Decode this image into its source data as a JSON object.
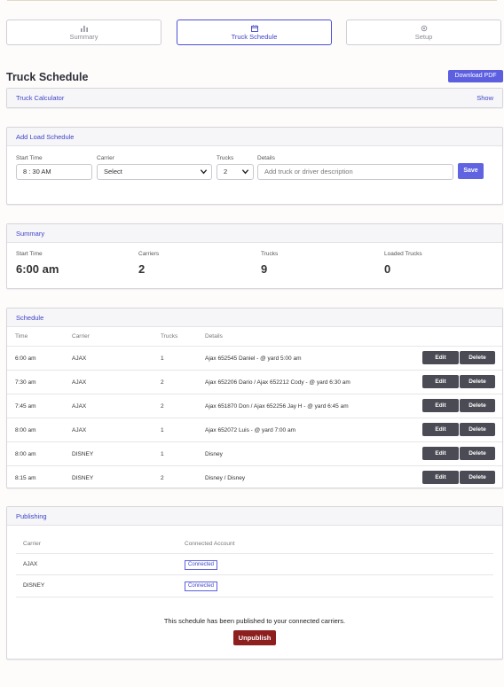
{
  "tabs": [
    {
      "label": "Summary",
      "icon": "bar-chart-icon"
    },
    {
      "label": "Truck Schedule",
      "icon": "calendar-icon"
    },
    {
      "label": "Setup",
      "icon": "gear-icon"
    }
  ],
  "active_tab": "Truck Schedule",
  "page_title": "Truck Schedule",
  "download_pdf_label": "Download PDF",
  "truck_calculator": {
    "title": "Truck Calculator",
    "show_label": "Show"
  },
  "add_load": {
    "title": "Add Load Schedule",
    "start_time_label": "Start Time",
    "start_time_value": "8 : 30 AM",
    "carrier_label": "Carrier",
    "carrier_value": "Select",
    "trucks_label": "Trucks",
    "trucks_value": "2",
    "details_label": "Details",
    "details_placeholder": "Add truck or driver description",
    "save_label": "Save"
  },
  "summary": {
    "title": "Summary",
    "items": [
      {
        "label": "Start Time",
        "value": "6:00 am"
      },
      {
        "label": "Carriers",
        "value": "2"
      },
      {
        "label": "Trucks",
        "value": "9"
      },
      {
        "label": "Loaded Trucks",
        "value": "0"
      }
    ]
  },
  "schedule": {
    "title": "Schedule",
    "headers": [
      "Time",
      "Carrier",
      "Trucks",
      "Details"
    ],
    "edit_label": "Edit",
    "delete_label": "Delete",
    "rows": [
      {
        "time": "6:00 am",
        "carrier": "AJAX",
        "trucks": "1",
        "details": "Ajax 652545 Daniel - @ yard 5:00 am"
      },
      {
        "time": "7:30 am",
        "carrier": "AJAX",
        "trucks": "2",
        "details": "Ajax 652206 Dario / Ajax 652212 Cody - @ yard 6:30 am"
      },
      {
        "time": "7:45 am",
        "carrier": "AJAX",
        "trucks": "2",
        "details": "Ajax 651870 Don / Ajax 652256 Jay H - @ yard 6:45 am"
      },
      {
        "time": "8:00 am",
        "carrier": "AJAX",
        "trucks": "1",
        "details": "Ajax 652072 Luis - @ yard 7:00 am"
      },
      {
        "time": "8:00 am",
        "carrier": "DISNEY",
        "trucks": "1",
        "details": "Disney"
      },
      {
        "time": "8:15 am",
        "carrier": "DISNEY",
        "trucks": "2",
        "details": "Disney / Disney"
      }
    ]
  },
  "publishing": {
    "title": "Publishing",
    "headers": [
      "Carrier",
      "Connected Account"
    ],
    "rows": [
      {
        "carrier": "AJAX",
        "status": "Connected"
      },
      {
        "carrier": "DISNEY",
        "status": "Connected"
      }
    ],
    "message": "This schedule has been published to your connected carriers.",
    "unpublish_label": "Unpublish"
  },
  "colors": {
    "accent": "#5b5fe0",
    "danger": "#8e1f1f",
    "button_dark": "#4b4b55"
  }
}
